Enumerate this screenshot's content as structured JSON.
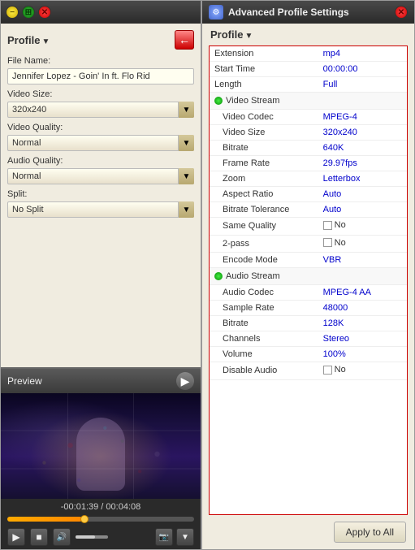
{
  "leftPanel": {
    "titleBtns": {
      "min": "−",
      "max": "⊞",
      "close": "✕"
    },
    "profileLabel": "Profile",
    "backBtn": "←",
    "fileNameLabel": "File Name:",
    "fileNameValue": "Jennifer Lopez - Goin' In ft. Flo Rid",
    "videoSizeLabel": "Video Size:",
    "videoSizeValue": "320x240",
    "videoQualityLabel": "Video Quality:",
    "videoQualityValue": "Normal",
    "audioQualityLabel": "Audio Quality:",
    "audioQualityValue": "Normal",
    "splitLabel": "Split:",
    "splitValue": "No Split",
    "previewLabel": "Preview",
    "timeline": "-00:01:39 / 00:04:08",
    "controls": {
      "play": "▶",
      "stop": "■",
      "volume": "🔊",
      "capture": "📷",
      "more": "▼"
    }
  },
  "rightPanel": {
    "titleIcon": "⚙",
    "title": "Advanced Profile Settings",
    "closeBtn": "✕",
    "profileLabel": "Profile",
    "settings": [
      {
        "key": "Extension",
        "value": "mp4",
        "type": "value"
      },
      {
        "key": "Start Time",
        "value": "00:00:00",
        "type": "time"
      },
      {
        "key": "Length",
        "value": "Full",
        "type": "value"
      },
      {
        "key": "Video Stream",
        "value": "",
        "type": "section"
      },
      {
        "key": "Video Codec",
        "value": "MPEG-4",
        "type": "value",
        "indent": true
      },
      {
        "key": "Video Size",
        "value": "320x240",
        "type": "value",
        "indent": true
      },
      {
        "key": "Bitrate",
        "value": "640K",
        "type": "value",
        "indent": true
      },
      {
        "key": "Frame Rate",
        "value": "29.97fps",
        "type": "value",
        "indent": true
      },
      {
        "key": "Zoom",
        "value": "Letterbox",
        "type": "value",
        "indent": true
      },
      {
        "key": "Aspect Ratio",
        "value": "Auto",
        "type": "value",
        "indent": true
      },
      {
        "key": "Bitrate Tolerance",
        "value": "Auto",
        "type": "value",
        "indent": true
      },
      {
        "key": "Same Quality",
        "value": "No",
        "type": "checkbox",
        "indent": true
      },
      {
        "key": "2-pass",
        "value": "No",
        "type": "checkbox",
        "indent": true
      },
      {
        "key": "Encode Mode",
        "value": "VBR",
        "type": "value",
        "indent": true
      },
      {
        "key": "Audio Stream",
        "value": "",
        "type": "section"
      },
      {
        "key": "Audio Codec",
        "value": "MPEG-4 AA",
        "type": "value",
        "indent": true
      },
      {
        "key": "Sample Rate",
        "value": "48000",
        "type": "value",
        "indent": true
      },
      {
        "key": "Bitrate",
        "value": "128K",
        "type": "value",
        "indent": true
      },
      {
        "key": "Channels",
        "value": "Stereo",
        "type": "value",
        "indent": true
      },
      {
        "key": "Volume",
        "value": "100%",
        "type": "value",
        "indent": true
      },
      {
        "key": "Disable Audio",
        "value": "No",
        "type": "checkbox",
        "indent": true
      }
    ],
    "applyBtn": "Apply to All"
  }
}
